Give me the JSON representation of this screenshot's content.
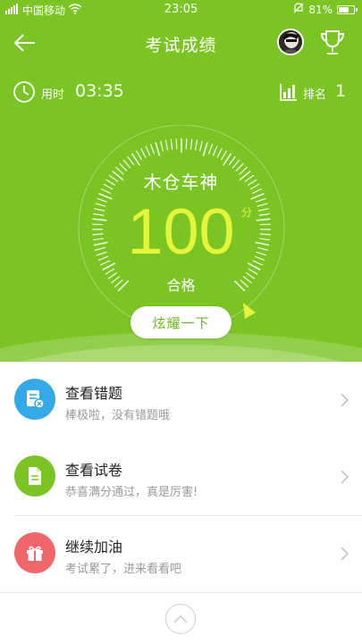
{
  "status_bar": {
    "carrier": "中国移动",
    "time": "23:05",
    "battery": "81%",
    "battery_level": 0.81
  },
  "nav": {
    "title": "考试成绩"
  },
  "stats": {
    "time_label": "用时",
    "time_value": "03:35",
    "rank_label": "排名",
    "rank_value": "1"
  },
  "result": {
    "player_name": "木仓车神",
    "score": "100",
    "score_unit": "分",
    "status": "合格",
    "score_fraction": 1.0,
    "share_label": "炫耀一下"
  },
  "list": [
    {
      "title": "查看错题",
      "subtitle": "棒极啦，没有错题哦",
      "icon": "wrong-questions-icon",
      "color": "#35a8e6"
    },
    {
      "title": "查看试卷",
      "subtitle": "恭喜满分通过，真是厉害!",
      "icon": "exam-paper-icon",
      "color": "#7ac524"
    },
    {
      "title": "继续加油",
      "subtitle": "考试累了，进来看看吧",
      "icon": "gift-icon",
      "color": "#f0666a"
    }
  ],
  "colors": {
    "header_green": "#7ac524",
    "score_yellow": "#e6f53a"
  }
}
